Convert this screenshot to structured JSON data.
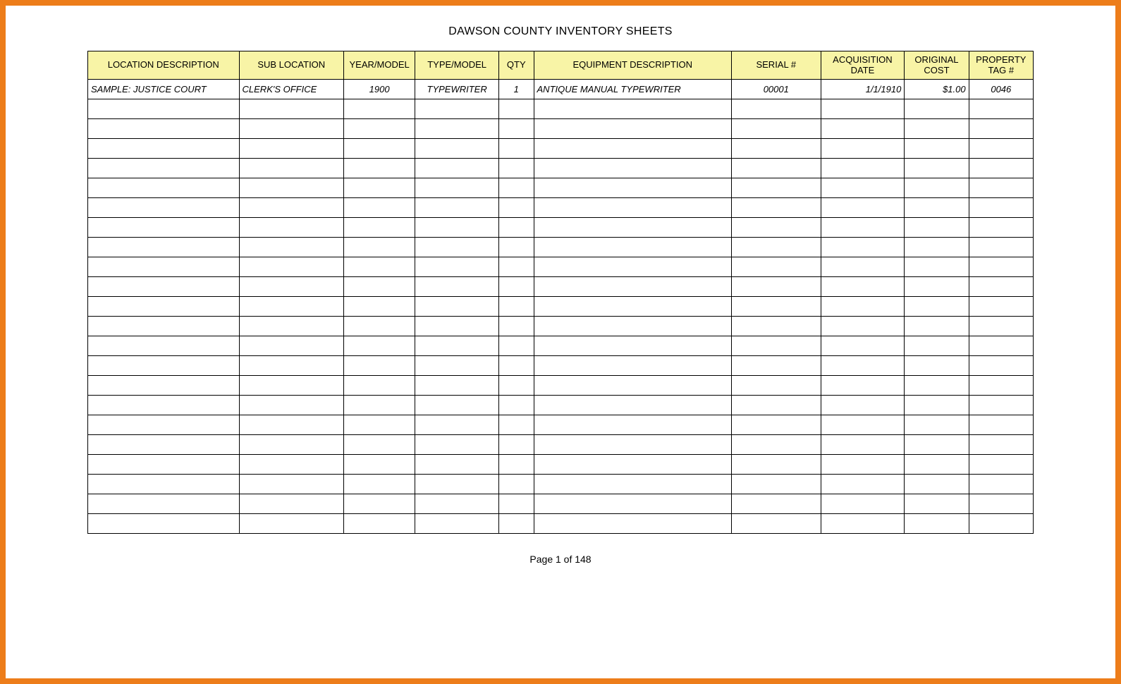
{
  "title": "DAWSON COUNTY INVENTORY SHEETS",
  "page_label": "Page 1 of 148",
  "columns": [
    {
      "label": "LOCATION DESCRIPTION"
    },
    {
      "label": "SUB LOCATION"
    },
    {
      "label": "YEAR/MODEL"
    },
    {
      "label": "TYPE/MODEL"
    },
    {
      "label": "QTY"
    },
    {
      "label": "EQUIPMENT DESCRIPTION"
    },
    {
      "label": "SERIAL #"
    },
    {
      "label_top": "ACQUISITION",
      "label_bottom": "DATE"
    },
    {
      "label_top": "ORIGINAL",
      "label_bottom": "COST"
    },
    {
      "label_top": "PROPERTY",
      "label_bottom": "TAG #"
    }
  ],
  "sample_row": {
    "location_description": "SAMPLE: JUSTICE COURT",
    "sub_location": "CLERK'S OFFICE",
    "year_model": "1900",
    "type_model": "TYPEWRITER",
    "qty": "1",
    "equipment_description": "ANTIQUE MANUAL TYPEWRITER",
    "serial": "00001",
    "acquisition_date": "1/1/1910",
    "original_cost": "$1.00",
    "property_tag": "0046"
  },
  "empty_row_count": 22
}
